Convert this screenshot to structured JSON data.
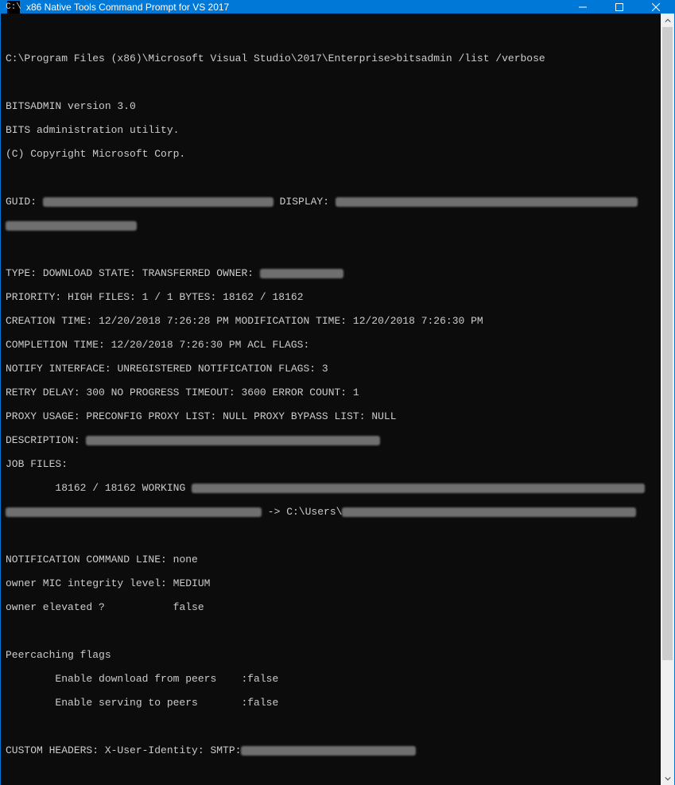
{
  "window": {
    "title": "x86 Native Tools Command Prompt for VS 2017",
    "icon_glyph": "C:\\"
  },
  "prompt": {
    "path": "C:\\Program Files (x86)\\Microsoft Visual Studio\\2017\\Enterprise>",
    "command": "bitsadmin /list /verbose"
  },
  "banner": {
    "line1": "BITSADMIN version 3.0",
    "line2": "BITS administration utility.",
    "line3": "(C) Copyright Microsoft Corp."
  },
  "fields": {
    "guid_label": "GUID: ",
    "display_label": " DISPLAY: ",
    "type_label": "TYPE: ",
    "type_value": "DOWNLOAD",
    "state_label": " STATE: ",
    "state_value": "TRANSFERRED",
    "owner_label": " OWNER: ",
    "priority_label": "PRIORITY: ",
    "priority_value": "HIGH",
    "files_label": " FILES: ",
    "files_value": "1 / 1",
    "bytes_label": " BYTES: ",
    "bytes_value": "18162 / 18162",
    "creation_label": "CREATION TIME: ",
    "creation_value": "12/20/2018 7:26:28 PM",
    "modification_label": " MODIFICATION TIME: ",
    "modification_value": "12/20/2018 7:26:30 PM",
    "completion_label": "COMPLETION TIME: ",
    "completion_value": "12/20/2018 7:26:30 PM",
    "acl_label": " ACL FLAGS:",
    "notify_if_label": "NOTIFY INTERFACE: ",
    "notify_if_value": "UNREGISTERED",
    "notify_flags_label": " NOTIFICATION FLAGS: ",
    "notify_flags_value": "3",
    "retry_label": "RETRY DELAY: ",
    "retry_value": "300",
    "noprog_label": " NO PROGRESS TIMEOUT: ",
    "noprog_value": "3600",
    "errcount_label": " ERROR COUNT: ",
    "errcount_value": "1",
    "proxy_usage_label": "PROXY USAGE: ",
    "proxy_usage_value": "PRECONFIG",
    "proxy_list_label": " PROXY LIST: ",
    "proxy_list_value": "NULL",
    "proxy_bypass_label": " PROXY BYPASS LIST: ",
    "proxy_bypass_value": "NULL",
    "description_label": "DESCRIPTION: ",
    "jobfiles_label": "JOB FILES:",
    "jobfile_bytes": "        18162 / 18162 ",
    "jobfile_status": "WORKING ",
    "jobfile_arrow": " -> C:\\Users\\",
    "ncl_label": "NOTIFICATION COMMAND LINE: ",
    "ncl_value": "none",
    "mic_label": "owner MIC integrity level: ",
    "mic_value": "MEDIUM",
    "elev_label": "owner elevated ?           ",
    "elev_value": "false",
    "peercache_header": "Peercaching flags",
    "peer_dl_label": "        Enable download from peers    :",
    "peer_dl_value": "false",
    "peer_srv_label": "        Enable serving to peers       :",
    "peer_srv_value": "false",
    "custom_headers_label": "CUSTOM HEADERS: ",
    "custom_headers_value": "X-User-Identity: SMTP:"
  }
}
